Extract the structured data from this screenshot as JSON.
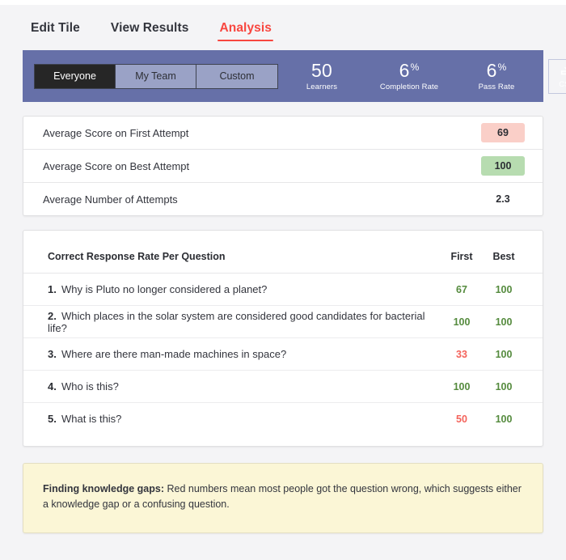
{
  "tabs": [
    {
      "label": "Edit Tile",
      "active": false
    },
    {
      "label": "View Results",
      "active": false
    },
    {
      "label": "Analysis",
      "active": true
    }
  ],
  "toolbar": {
    "audience_segments": [
      {
        "label": "Everyone",
        "active": true
      },
      {
        "label": "My Team",
        "active": false
      },
      {
        "label": "Custom",
        "active": false
      }
    ],
    "stats": [
      {
        "value": "50",
        "suffix": "",
        "caption": "Learners"
      },
      {
        "value": "6",
        "suffix": "%",
        "caption": "Completion Rate"
      },
      {
        "value": "6",
        "suffix": "%",
        "caption": "Pass Rate"
      }
    ],
    "export": {
      "label": "CSV",
      "icon": "download-tray-icon"
    },
    "accent_color": "#6670a8",
    "segment_active_color": "#262626",
    "segment_inactive_color": "#9aa2c6"
  },
  "summary": {
    "rows": [
      {
        "label": "Average Score on First Attempt",
        "value": "69",
        "style": "pink"
      },
      {
        "label": "Average Score on Best Attempt",
        "value": "100",
        "style": "green"
      },
      {
        "label": "Average Number of Attempts",
        "value": "2.3",
        "style": "plain"
      }
    ],
    "pink_color": "#facfc8",
    "green_color": "#b7dcb0"
  },
  "question_table": {
    "title": "Correct Response Rate Per Question",
    "columns": [
      "First",
      "Best"
    ],
    "rows": [
      {
        "index": "1.",
        "question": "Why is Pluto no longer considered a planet?",
        "first": "67",
        "first_state": "good",
        "best": "100",
        "best_state": "good"
      },
      {
        "index": "2.",
        "question": "Which places in the solar system are considered good candidates for bacterial life?",
        "first": "100",
        "first_state": "good",
        "best": "100",
        "best_state": "good"
      },
      {
        "index": "3.",
        "question": "Where are there man-made machines in space?",
        "first": "33",
        "first_state": "bad",
        "best": "100",
        "best_state": "good"
      },
      {
        "index": "4.",
        "question": "Who is this?",
        "first": "100",
        "first_state": "good",
        "best": "100",
        "best_state": "good"
      },
      {
        "index": "5.",
        "question": "What is this?",
        "first": "50",
        "first_state": "bad",
        "best": "100",
        "best_state": "good"
      }
    ],
    "good_color": "#558b3e",
    "bad_color": "#f4635b"
  },
  "note": {
    "heading": "Finding knowledge gaps:",
    "body": " Red numbers mean most people got the question wrong, which suggests either a knowledge gap or a confusing question.",
    "background_color": "#fbf6d6"
  }
}
